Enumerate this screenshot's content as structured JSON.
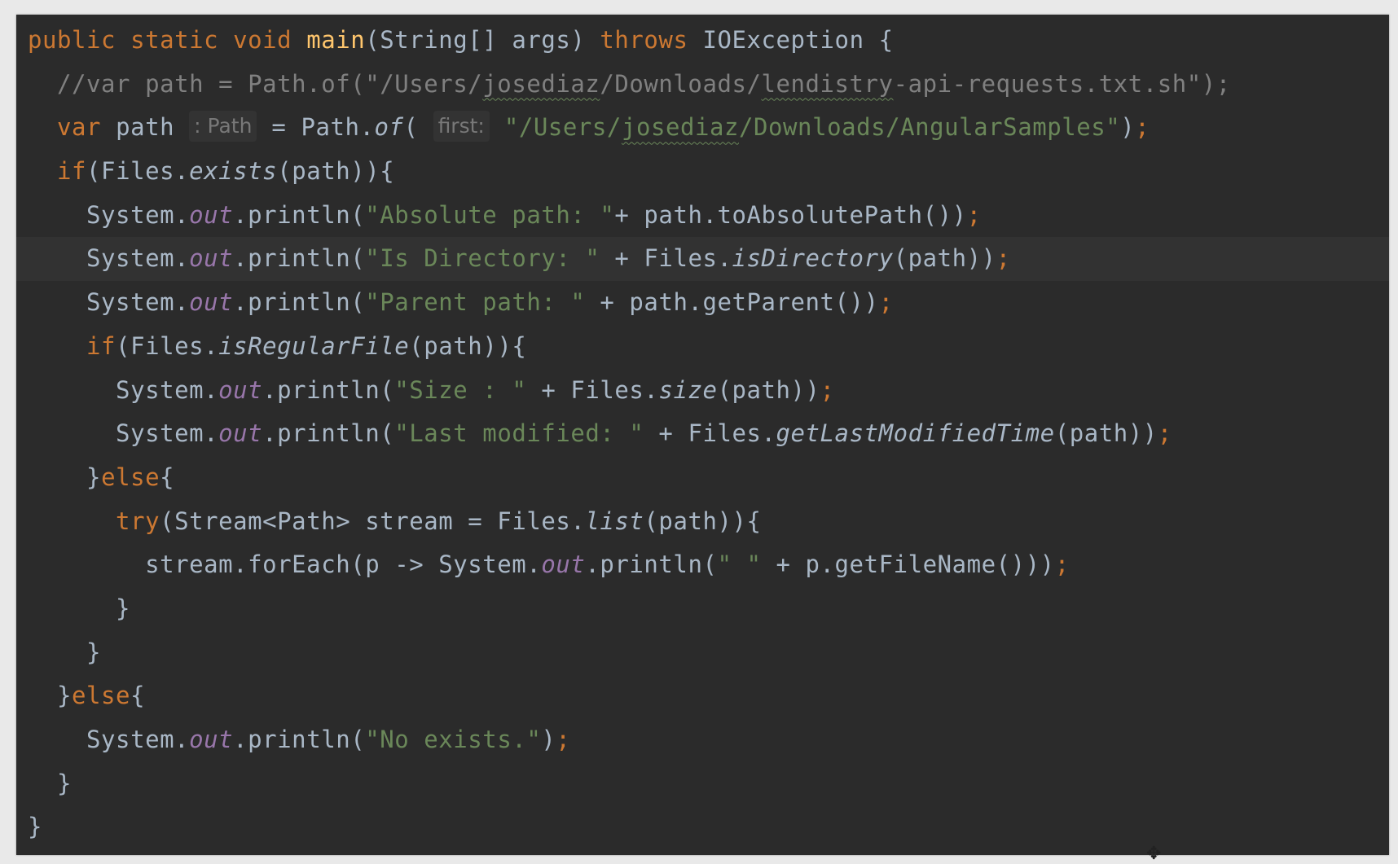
{
  "editor": {
    "language": "java",
    "colors": {
      "background": "#2b2b2b",
      "keyword": "#cc7832",
      "method_declaration": "#ffc66d",
      "string": "#6a8759",
      "comment": "#808080",
      "static_field": "#9876aa",
      "plain": "#a9b7c6"
    },
    "cursor_icon": "move-cursor-icon",
    "lines": [
      [
        {
          "t": "kw",
          "v": "public static void "
        },
        {
          "t": "fn",
          "v": "main"
        },
        {
          "t": "",
          "v": "(String[] args) "
        },
        {
          "t": "kw",
          "v": "throws "
        },
        {
          "t": "",
          "v": "IOException {"
        }
      ],
      [
        {
          "t": "cmt",
          "v": "  //var path = Path.of(\"/Users/"
        },
        {
          "t": "cmt typo",
          "v": "josediaz"
        },
        {
          "t": "cmt",
          "v": "/Downloads/"
        },
        {
          "t": "cmt typo",
          "v": "lendistry"
        },
        {
          "t": "cmt",
          "v": "-api-requests.txt.sh\");"
        }
      ],
      [
        {
          "t": "kw",
          "v": "  var "
        },
        {
          "t": "",
          "v": "path "
        },
        {
          "t": "hint",
          "v": ": Path"
        },
        {
          "t": "",
          "v": " = Path."
        },
        {
          "t": "it",
          "v": "of"
        },
        {
          "t": "",
          "v": "( "
        },
        {
          "t": "hint",
          "v": "first:"
        },
        {
          "t": "str",
          "v": " \"/Users/"
        },
        {
          "t": "str typo",
          "v": "josediaz"
        },
        {
          "t": "str",
          "v": "/Downloads/AngularSamples\""
        },
        {
          "t": "",
          "v": ")"
        },
        {
          "t": "kw",
          "v": ";"
        }
      ],
      [
        {
          "t": "kw",
          "v": "  if"
        },
        {
          "t": "",
          "v": "(Files."
        },
        {
          "t": "it",
          "v": "exists"
        },
        {
          "t": "",
          "v": "(path)){"
        }
      ],
      [
        {
          "t": "",
          "v": "    System."
        },
        {
          "t": "fld",
          "v": "out"
        },
        {
          "t": "",
          "v": ".println("
        },
        {
          "t": "str",
          "v": "\"Absolute path: \""
        },
        {
          "t": "",
          "v": "+ path.toAbsolutePath())"
        },
        {
          "t": "kw",
          "v": ";"
        }
      ],
      [
        {
          "t": "",
          "v": "    System."
        },
        {
          "t": "fld",
          "v": "out"
        },
        {
          "t": "",
          "v": ".println("
        },
        {
          "t": "str",
          "v": "\"Is Directory: \""
        },
        {
          "t": "",
          "v": " + Files."
        },
        {
          "t": "it",
          "v": "isDirectory"
        },
        {
          "t": "",
          "v": "(path))"
        },
        {
          "t": "kw",
          "v": ";"
        }
      ],
      [
        {
          "t": "",
          "v": "    System."
        },
        {
          "t": "fld",
          "v": "out"
        },
        {
          "t": "",
          "v": ".println("
        },
        {
          "t": "str",
          "v": "\"Parent path: \""
        },
        {
          "t": "",
          "v": " + path.getParent())"
        },
        {
          "t": "kw",
          "v": ";"
        }
      ],
      [
        {
          "t": "kw",
          "v": "    if"
        },
        {
          "t": "",
          "v": "(Files."
        },
        {
          "t": "it",
          "v": "isRegularFile"
        },
        {
          "t": "",
          "v": "(path)){"
        }
      ],
      [
        {
          "t": "",
          "v": "      System."
        },
        {
          "t": "fld",
          "v": "out"
        },
        {
          "t": "",
          "v": ".println("
        },
        {
          "t": "str",
          "v": "\"Size : \""
        },
        {
          "t": "",
          "v": " + Files."
        },
        {
          "t": "it",
          "v": "size"
        },
        {
          "t": "",
          "v": "(path))"
        },
        {
          "t": "kw",
          "v": ";"
        }
      ],
      [
        {
          "t": "",
          "v": "      System."
        },
        {
          "t": "fld",
          "v": "out"
        },
        {
          "t": "",
          "v": ".println("
        },
        {
          "t": "str",
          "v": "\"Last modified: \""
        },
        {
          "t": "",
          "v": " + Files."
        },
        {
          "t": "it",
          "v": "getLastModifiedTime"
        },
        {
          "t": "",
          "v": "(path))"
        },
        {
          "t": "kw",
          "v": ";"
        }
      ],
      [
        {
          "t": "",
          "v": "    }"
        },
        {
          "t": "kw",
          "v": "else"
        },
        {
          "t": "",
          "v": "{"
        }
      ],
      [
        {
          "t": "kw",
          "v": "      try"
        },
        {
          "t": "",
          "v": "(Stream<Path> stream = Files."
        },
        {
          "t": "it",
          "v": "list"
        },
        {
          "t": "",
          "v": "(path)){"
        }
      ],
      [
        {
          "t": "",
          "v": "        stream.forEach(p -> System."
        },
        {
          "t": "fld",
          "v": "out"
        },
        {
          "t": "",
          "v": ".println("
        },
        {
          "t": "str",
          "v": "\" \""
        },
        {
          "t": "",
          "v": " + p.getFileName()))"
        },
        {
          "t": "kw",
          "v": ";"
        }
      ],
      [
        {
          "t": "",
          "v": "      }"
        }
      ],
      [
        {
          "t": "",
          "v": "    }"
        }
      ],
      [
        {
          "t": "",
          "v": "  }"
        },
        {
          "t": "kw",
          "v": "else"
        },
        {
          "t": "",
          "v": "{"
        }
      ],
      [
        {
          "t": "",
          "v": "    System."
        },
        {
          "t": "fld",
          "v": "out"
        },
        {
          "t": "",
          "v": ".println("
        },
        {
          "t": "str",
          "v": "\"No exists.\""
        },
        {
          "t": "",
          "v": ")"
        },
        {
          "t": "kw",
          "v": ";"
        }
      ],
      [
        {
          "t": "",
          "v": "  }"
        }
      ],
      [
        {
          "t": "",
          "v": "}"
        }
      ]
    ]
  }
}
